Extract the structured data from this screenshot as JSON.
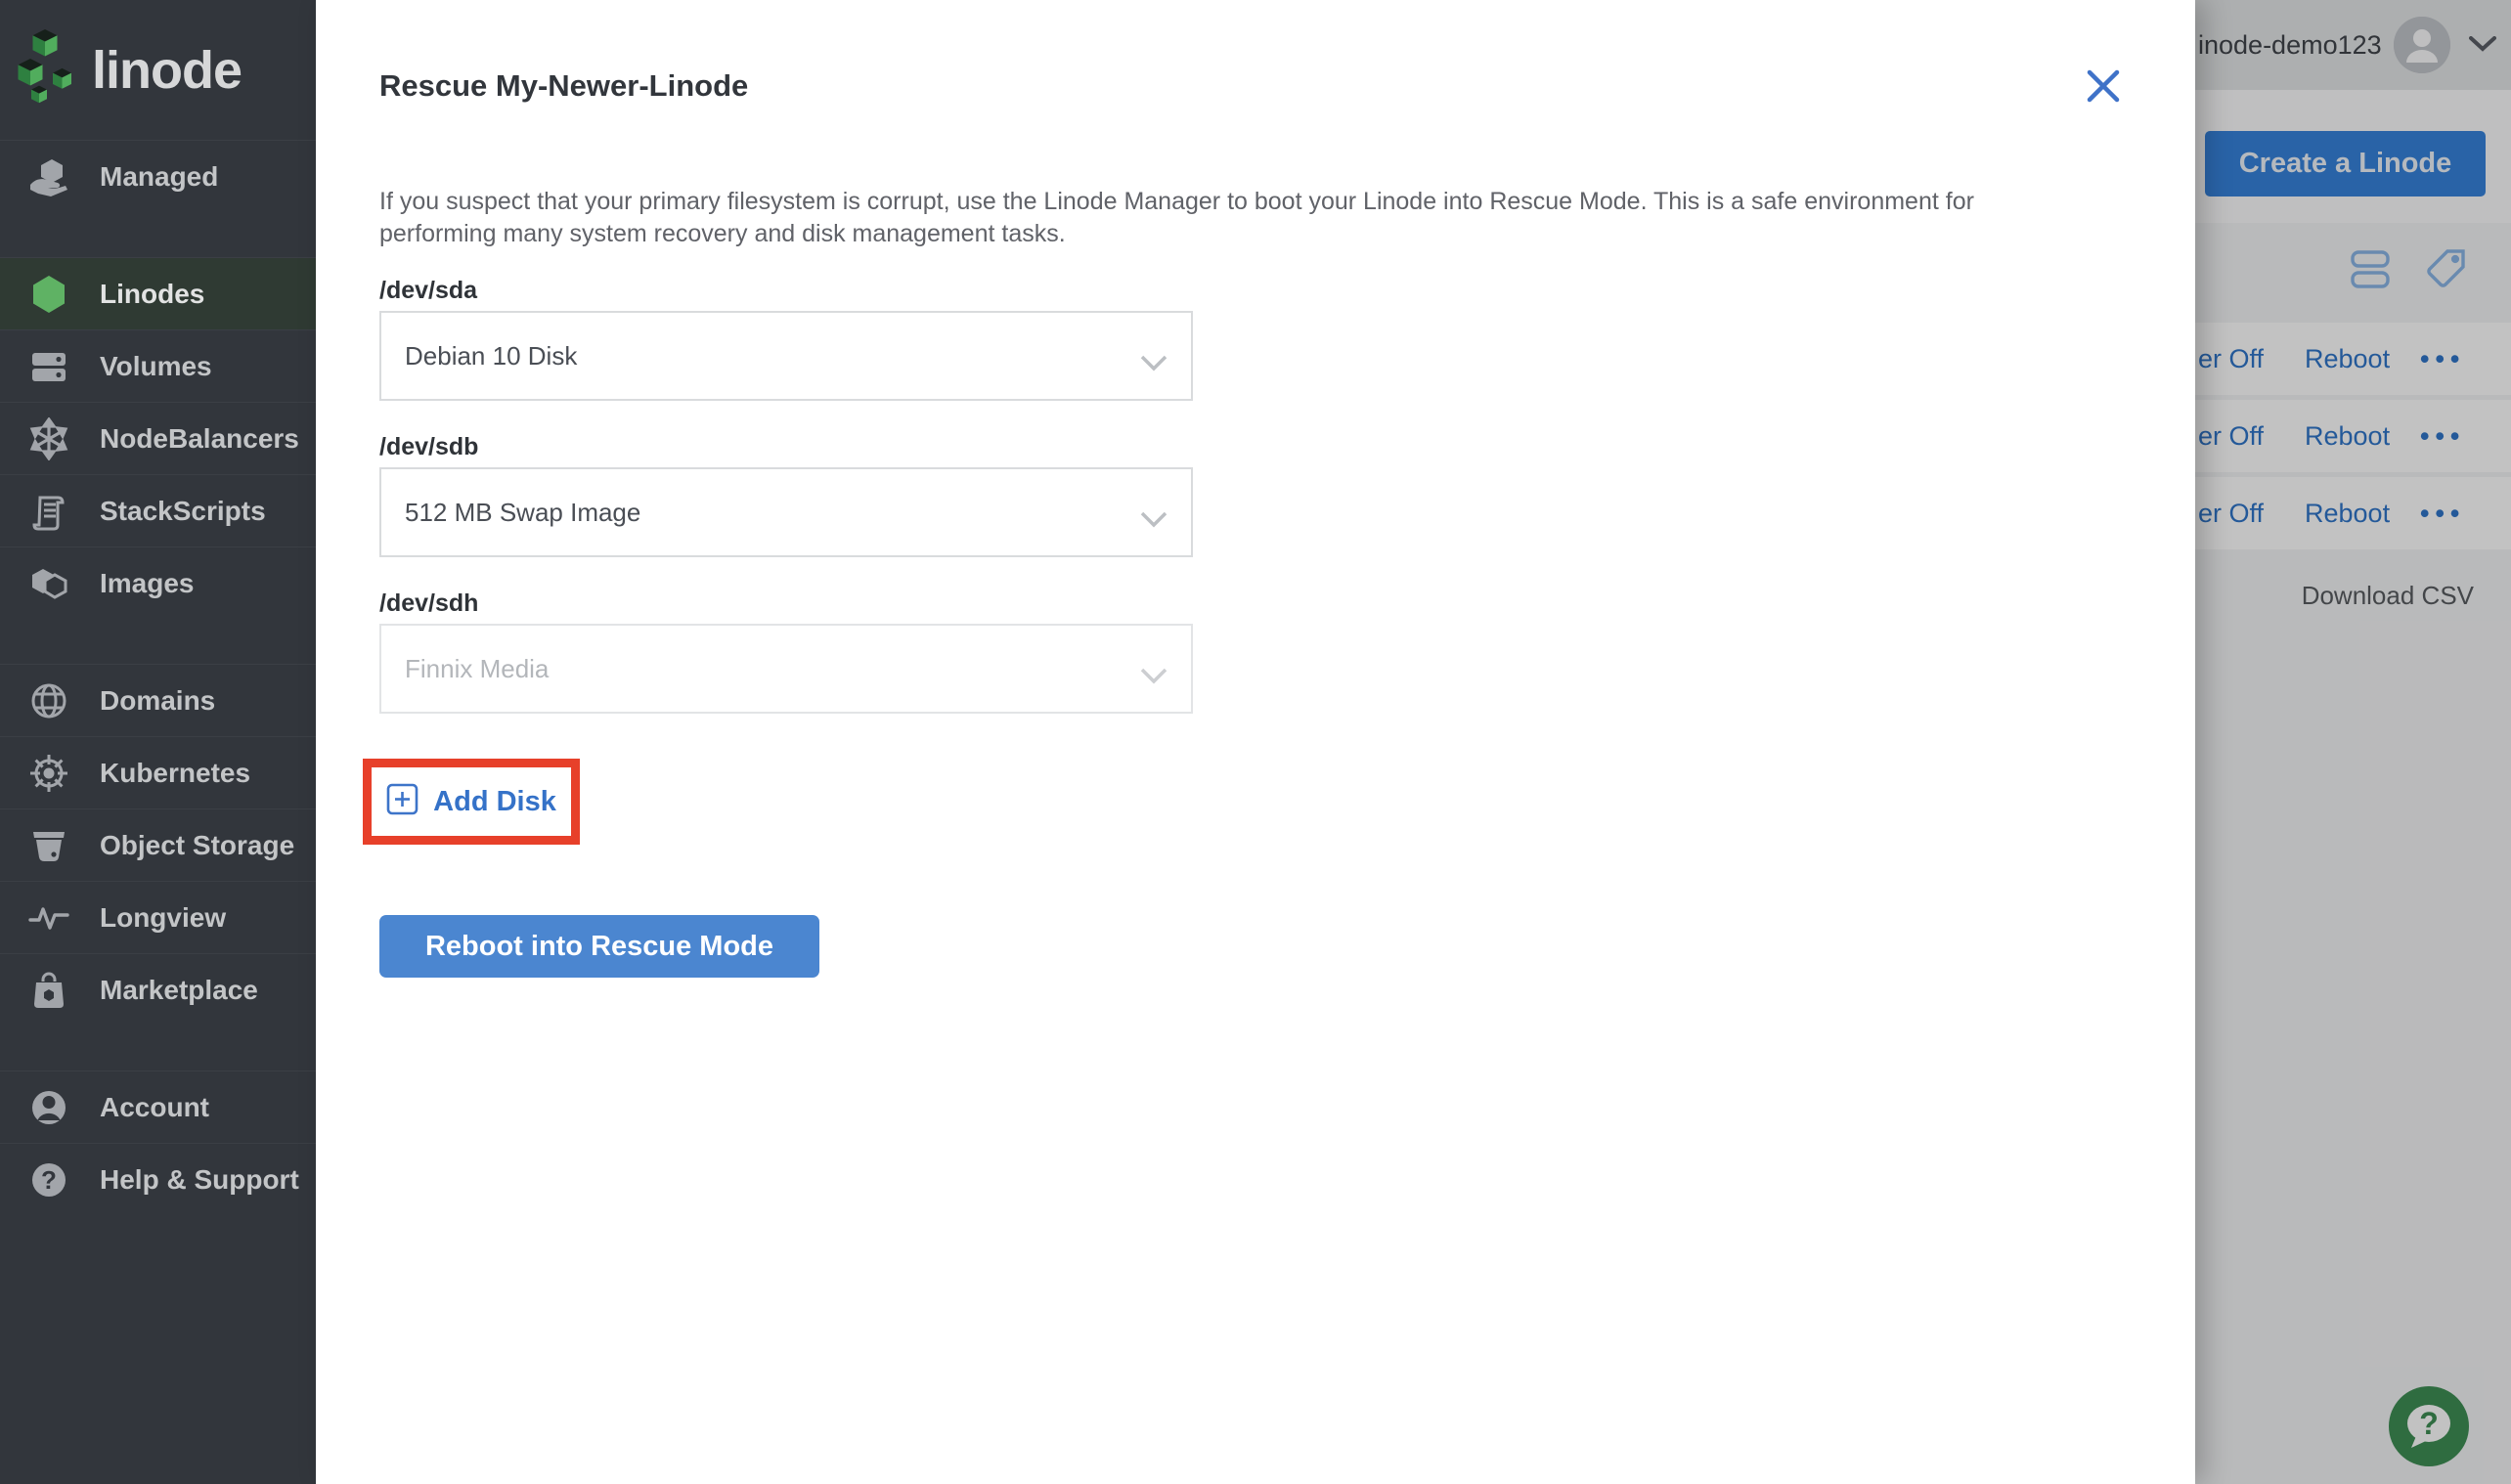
{
  "app": {
    "logo_text": "linode"
  },
  "sidebar": {
    "groups": [
      {
        "items": [
          {
            "label": "Managed",
            "icon": "managed-icon"
          }
        ]
      },
      {
        "items": [
          {
            "label": "Linodes",
            "icon": "linode-hexagon-icon"
          },
          {
            "label": "Volumes",
            "icon": "volumes-icon"
          },
          {
            "label": "NodeBalancers",
            "icon": "nodebalancers-icon"
          },
          {
            "label": "StackScripts",
            "icon": "stackscripts-icon"
          },
          {
            "label": "Images",
            "icon": "images-icon"
          }
        ]
      },
      {
        "items": [
          {
            "label": "Domains",
            "icon": "domains-globe-icon"
          },
          {
            "label": "Kubernetes",
            "icon": "kubernetes-helm-icon"
          },
          {
            "label": "Object Storage",
            "icon": "object-storage-bucket-icon"
          },
          {
            "label": "Longview",
            "icon": "longview-pulse-icon"
          },
          {
            "label": "Marketplace",
            "icon": "marketplace-bag-icon"
          }
        ]
      },
      {
        "items": [
          {
            "label": "Account",
            "icon": "account-icon"
          },
          {
            "label": "Help & Support",
            "icon": "help-icon"
          }
        ]
      }
    ]
  },
  "topbar": {
    "account_name": "inode-demo123",
    "avatar_icon": "user-avatar-icon",
    "chevron_icon": "chevron-down-icon"
  },
  "page": {
    "create_button_label": "Create a Linode",
    "view_icons": [
      "list-view-icon",
      "tag-icon"
    ],
    "rows": [
      {
        "power_label": "er Off",
        "reboot_label": "Reboot",
        "more_label": "•••"
      },
      {
        "power_label": "er Off",
        "reboot_label": "Reboot",
        "more_label": "•••"
      },
      {
        "power_label": "er Off",
        "reboot_label": "Reboot",
        "more_label": "•••"
      }
    ],
    "download_csv_label": "Download CSV",
    "help_button_icon": "help-chat-icon"
  },
  "drawer": {
    "title": "Rescue My-Newer-Linode",
    "close_icon": "close-icon",
    "description": "If you suspect that your primary filesystem is corrupt, use the Linode Manager to boot your Linode into Rescue Mode. This is a safe environment for performing many system recovery and disk management tasks.",
    "fields": [
      {
        "label": "/dev/sda",
        "value": "Debian 10 Disk",
        "disabled": false
      },
      {
        "label": "/dev/sdb",
        "value": "512 MB Swap Image",
        "disabled": false
      },
      {
        "label": "/dev/sdh",
        "value": "Finnix Media",
        "disabled": true
      }
    ],
    "add_disk": {
      "label": "Add Disk",
      "icon": "plus-square-icon"
    },
    "reboot_button_label": "Reboot into Rescue Mode"
  },
  "colors": {
    "sidebar_bg": "#32363c",
    "active_item_bg": "#2f3a33",
    "brand_green": "#5fb264",
    "accent_blue": "#3683dc",
    "highlight_red": "#e7402a",
    "help_green": "#3e8f55"
  }
}
